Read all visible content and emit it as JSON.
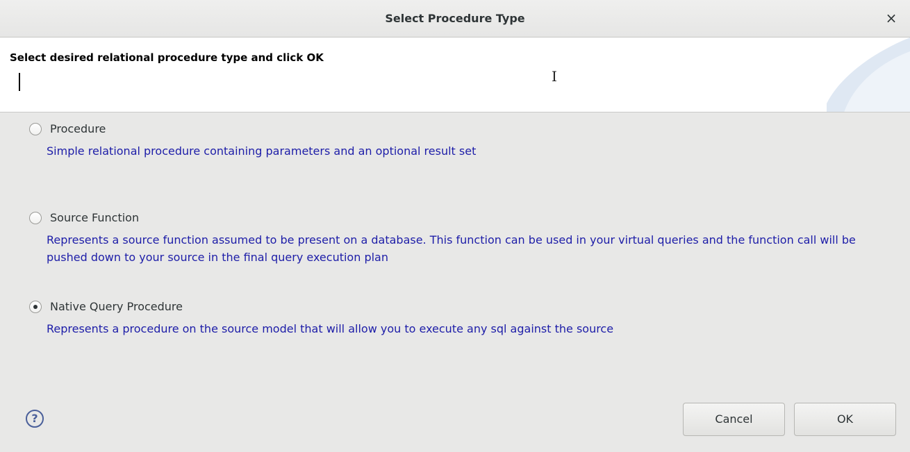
{
  "dialog": {
    "title": "Select Procedure Type",
    "close_label": "×"
  },
  "banner": {
    "heading": "Select desired relational procedure type and click OK"
  },
  "options": [
    {
      "label": "Procedure",
      "description": "Simple relational procedure containing parameters and an optional result set",
      "checked": false
    },
    {
      "label": "Source Function",
      "description": "Represents a source function assumed to be present on a database. This function can be used in your virtual queries and the function call will be pushed down to your source in the final query execution plan",
      "checked": false
    },
    {
      "label": "Native Query Procedure",
      "description": "Represents a procedure on the source model that will allow you to execute any sql against the source",
      "checked": true
    }
  ],
  "footer": {
    "help_label": "?",
    "cancel_label": "Cancel",
    "ok_label": "OK"
  },
  "colors": {
    "description_text": "#1d1da8",
    "banner_accent": "#dce6f2"
  },
  "icons": {
    "help": "help-circle-icon",
    "close": "close-icon",
    "cursor": "text-cursor-icon"
  }
}
